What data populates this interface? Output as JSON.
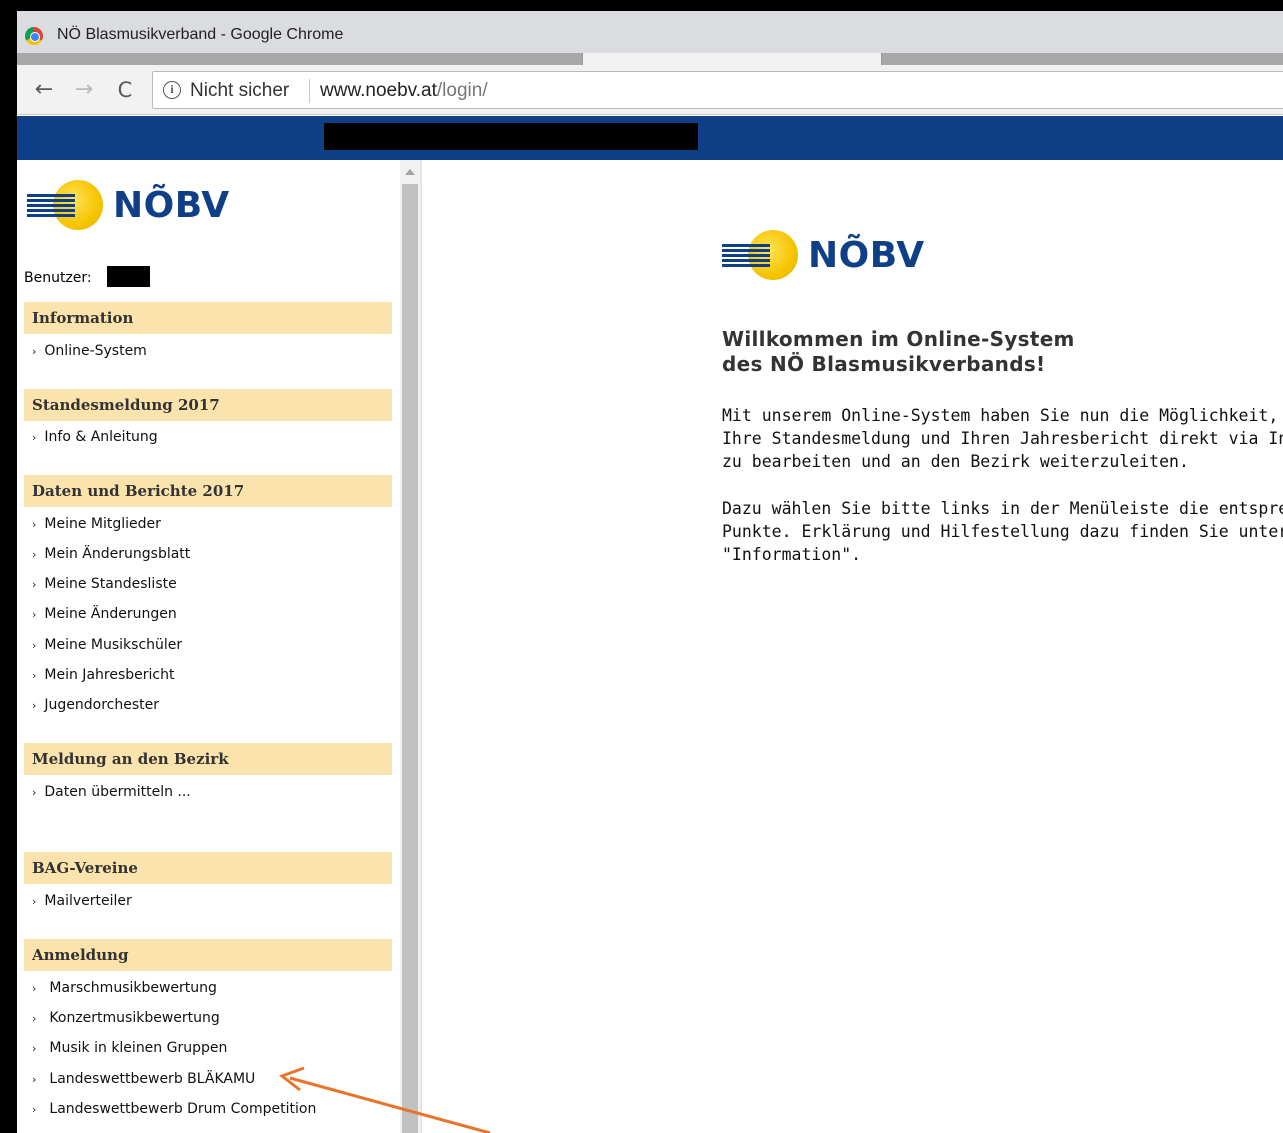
{
  "window": {
    "title": "NÖ Blasmusikverband - Google Chrome"
  },
  "toolbar": {
    "back": "←",
    "forward": "→",
    "reload": "C",
    "security_label": "Nicht sicher",
    "url_host": "www.noebv.at",
    "url_path": "/login/"
  },
  "brand": {
    "name": "NÕBV"
  },
  "sidebar": {
    "user_label": "Benutzer:",
    "sections": [
      {
        "title": "Information",
        "items": [
          "Online-System"
        ]
      },
      {
        "title": "Standesmeldung 2017",
        "items": [
          "Info & Anleitung"
        ]
      },
      {
        "title": "Daten und Berichte 2017",
        "items": [
          "Meine Mitglieder",
          "Mein Änderungsblatt",
          "Meine Standesliste",
          "Meine Änderungen",
          "Meine Musikschüler",
          "Mein Jahresbericht",
          "Jugendorchester"
        ]
      },
      {
        "title": "Meldung an den Bezirk",
        "items": [
          "Daten übermitteln ..."
        ]
      },
      {
        "title": "BAG-Vereine",
        "items": [
          "Mailverteiler"
        ]
      },
      {
        "title": "Anmeldung",
        "items": [
          "Marschmusikbewertung",
          "Konzertmusikbewertung",
          "Musik in kleinen Gruppen",
          "Landeswettbewerb BLÄKAMU",
          "Landeswettbewerb Drum Competition"
        ]
      }
    ]
  },
  "main": {
    "welcome_line1": "Willkommen im Online-System",
    "welcome_line2": "des NÖ Blasmusikverbands!",
    "para1": [
      "Mit unserem Online-System haben Sie nun die Möglichkeit,",
      "Ihre Standesmeldung und Ihren Jahresbericht direkt via In",
      "zu bearbeiten und an den Bezirk weiterzuleiten."
    ],
    "para2": [
      "Dazu wählen Sie bitte links in der Menüleiste die entsprech",
      "Punkte. Erklärung und Hilfestellung dazu finden Sie unter d",
      "\"Information\"."
    ]
  },
  "colors": {
    "brand_blue": "#0f3f87",
    "section_bg": "#fbe3ad",
    "annotation_arrow": "#e8742a"
  },
  "icons": [
    "chrome-logo-icon",
    "back-arrow-icon",
    "forward-arrow-icon",
    "reload-icon",
    "info-icon",
    "scroll-up-icon",
    "menu-chevron-icon",
    "annotation-arrow-icon"
  ]
}
